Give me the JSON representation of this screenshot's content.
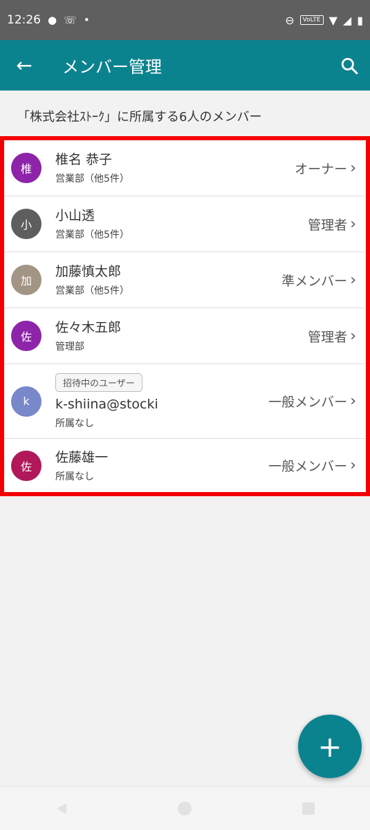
{
  "status": {
    "time": "12:26",
    "volte": "VoLTE"
  },
  "appbar": {
    "title": "メンバー管理",
    "back_icon": "arrow-left-icon",
    "search_icon": "search-icon"
  },
  "caption": "「株式会社ｽﾄｰｸ」に所属する6人のメンバー",
  "members": [
    {
      "avatar": "椎",
      "avatar_color": "#8e24aa",
      "name": "椎名 恭子",
      "dept": "営業部（他5件）",
      "role": "オーナー"
    },
    {
      "avatar": "小",
      "avatar_color": "#5e5e5e",
      "name": "小山透",
      "dept": "営業部（他5件）",
      "role": "管理者"
    },
    {
      "avatar": "加",
      "avatar_color": "#a39585",
      "name": "加藤慎太郎",
      "dept": "営業部（他5件）",
      "role": "準メンバー"
    },
    {
      "avatar": "佐",
      "avatar_color": "#8e24aa",
      "name": "佐々木五郎",
      "dept": "管理部",
      "role": "管理者"
    },
    {
      "avatar": "k",
      "avatar_color": "#7987cb",
      "badge": "招待中のユーザー",
      "name": "k-shiina@stocki",
      "dept": "所属なし",
      "role": "一般メンバー"
    },
    {
      "avatar": "佐",
      "avatar_color": "#b0185a",
      "name": "佐藤雄一",
      "dept": "所属なし",
      "role": "一般メンバー"
    }
  ],
  "fab": {
    "label": "+"
  },
  "colors": {
    "primary": "#0b838e",
    "highlight": "#f30000"
  }
}
